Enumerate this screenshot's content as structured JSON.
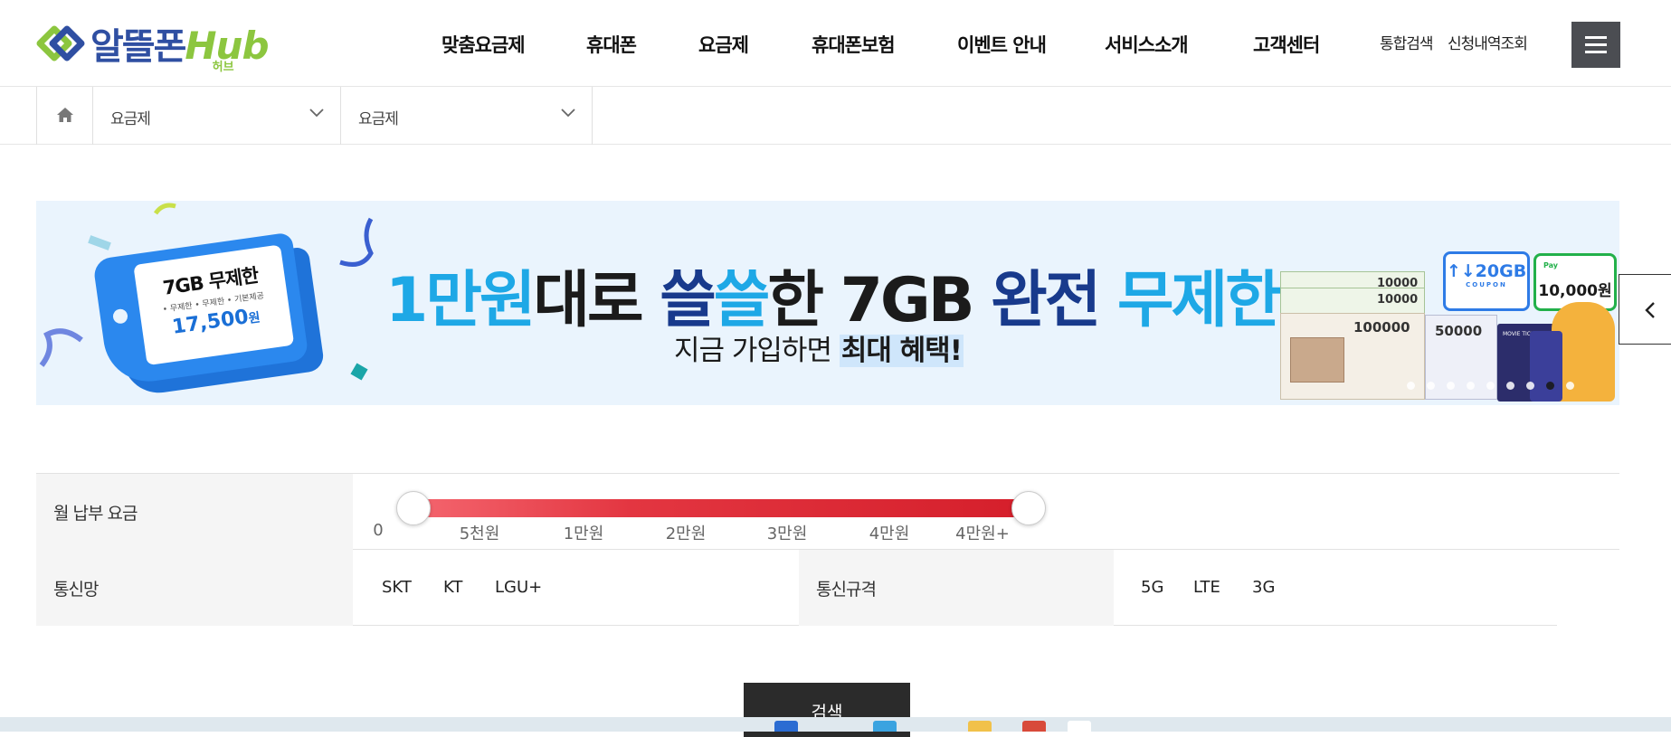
{
  "header": {
    "logo": {
      "main": "알뜰폰",
      "hub": "Hub",
      "sub": "허브"
    },
    "nav": [
      "맞춤요금제",
      "휴대폰",
      "요금제",
      "휴대폰보험",
      "이벤트 안내",
      "서비스소개",
      "고객센터"
    ],
    "util": [
      "통합검색",
      "신청내역조회"
    ]
  },
  "breadcrumb": {
    "level1": "요금제",
    "level2": "요금제"
  },
  "banner": {
    "tag": {
      "title": "7GB 무제한",
      "features": "• 무제한  • 무제한  • 기본제공",
      "price": "17,500",
      "unit": "원"
    },
    "headline": {
      "p1": "1만원",
      "p2": "대로 ",
      "p3": "쓸",
      "p4": "쓸",
      "p5": "한 7GB ",
      "p6": "완전 ",
      "p7": "무제한"
    },
    "sub": {
      "text": "지금 가입하면 ",
      "highlight": "최대 혜택!"
    },
    "prizes": {
      "data_coupon": "↑↓20GB",
      "coupon_label": "COUPON",
      "pay_label": "Pay",
      "pay_amount": "10,000원",
      "voucher_small": "10000",
      "voucher_large": "100000",
      "voucher_mid": "50000",
      "movie": "MOVIE TICKET"
    }
  },
  "filter": {
    "fee": {
      "label": "월 납부 요금",
      "ticks": [
        "0",
        "5천원",
        "1만원",
        "2만원",
        "3만원",
        "4만원",
        "4만원+"
      ],
      "range_min": "0",
      "range_max": "4만원+"
    },
    "network": {
      "label": "통신망",
      "options": [
        "SKT",
        "KT",
        "LGU+"
      ]
    },
    "spec": {
      "label": "통신규격",
      "options": [
        "5G",
        "LTE",
        "3G"
      ]
    }
  },
  "search_button": "검색",
  "colors": {
    "brand_blue": "#2f4fa2",
    "brand_green": "#8cc63f",
    "slider_red": "#d51f2b",
    "banner_cyan": "#1ea8e6",
    "banner_navy": "#183a8c"
  }
}
